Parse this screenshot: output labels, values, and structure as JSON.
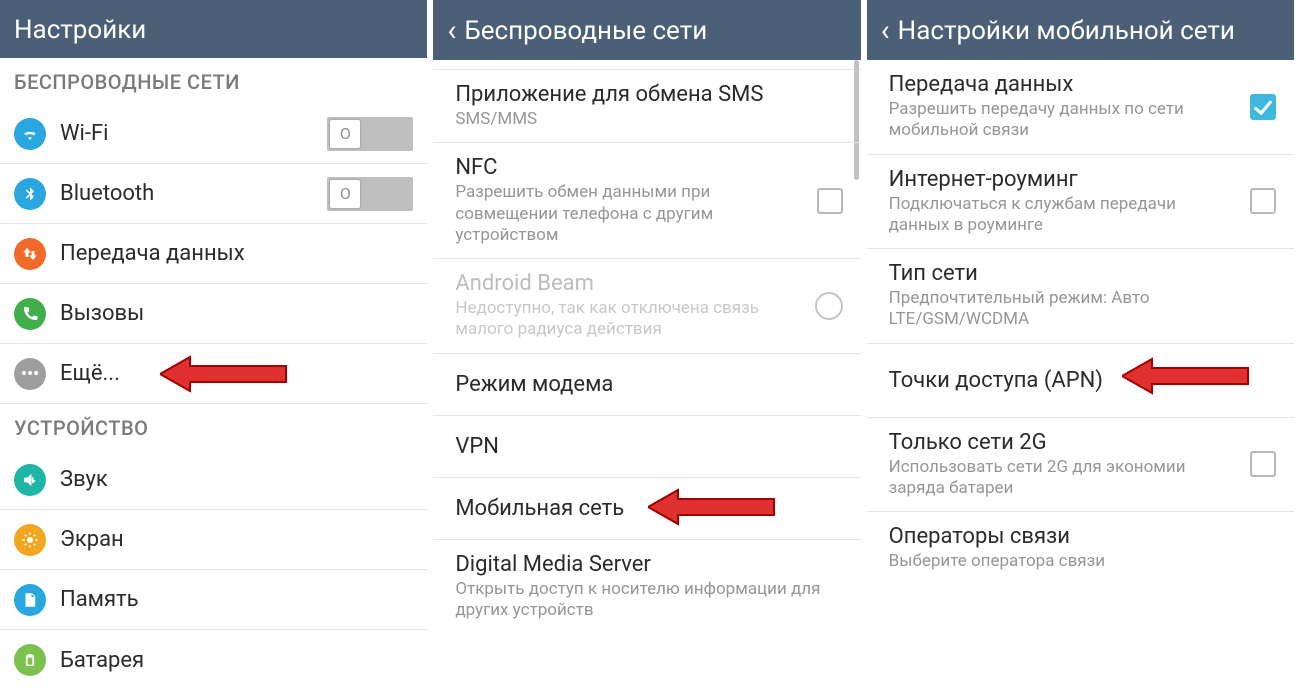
{
  "panel1": {
    "title": "Настройки",
    "section1": "БЕСПРОВОДНЫЕ СЕТИ",
    "wifi": "Wi-Fi",
    "bluetooth": "Bluetooth",
    "data": "Передача данных",
    "calls": "Вызовы",
    "more": "Ещё...",
    "toggle_off": "O",
    "section2": "УСТРОЙСТВО",
    "sound": "Звук",
    "screen": "Экран",
    "memory": "Память",
    "battery": "Батарея"
  },
  "panel2": {
    "title": "Беспроводные сети",
    "sms_t": "Приложение для обмена SMS",
    "sms_s": "SMS/MMS",
    "nfc_t": "NFC",
    "nfc_s": "Разрешить обмен данными при совмещении телефона с другим устройством",
    "beam_t": "Android Beam",
    "beam_s": "Недоступно, так как отключена связь малого радиуса действия",
    "modem": "Режим модема",
    "vpn": "VPN",
    "mobile": "Мобильная сеть",
    "dms_t": "Digital Media Server",
    "dms_s": "Открыть доступ к носителю информации для других устройств"
  },
  "panel3": {
    "title": "Настройки мобильной сети",
    "data_t": "Передача данных",
    "data_s": "Разрешить передачу данных по сети мобильной связи",
    "roam_t": "Интернет-роуминг",
    "roam_s": "Подключаться к службам передачи данных в роуминге",
    "type_t": "Тип сети",
    "type_s": "Предпочтительный режим: Авто LTE/GSM/WCDMA",
    "apn_t": "Точки доступа (APN)",
    "g2_t": "Только сети 2G",
    "g2_s": "Использовать сети 2G для экономии заряда батареи",
    "op_t": "Операторы связи",
    "op_s": "Выберите оператора связи"
  }
}
